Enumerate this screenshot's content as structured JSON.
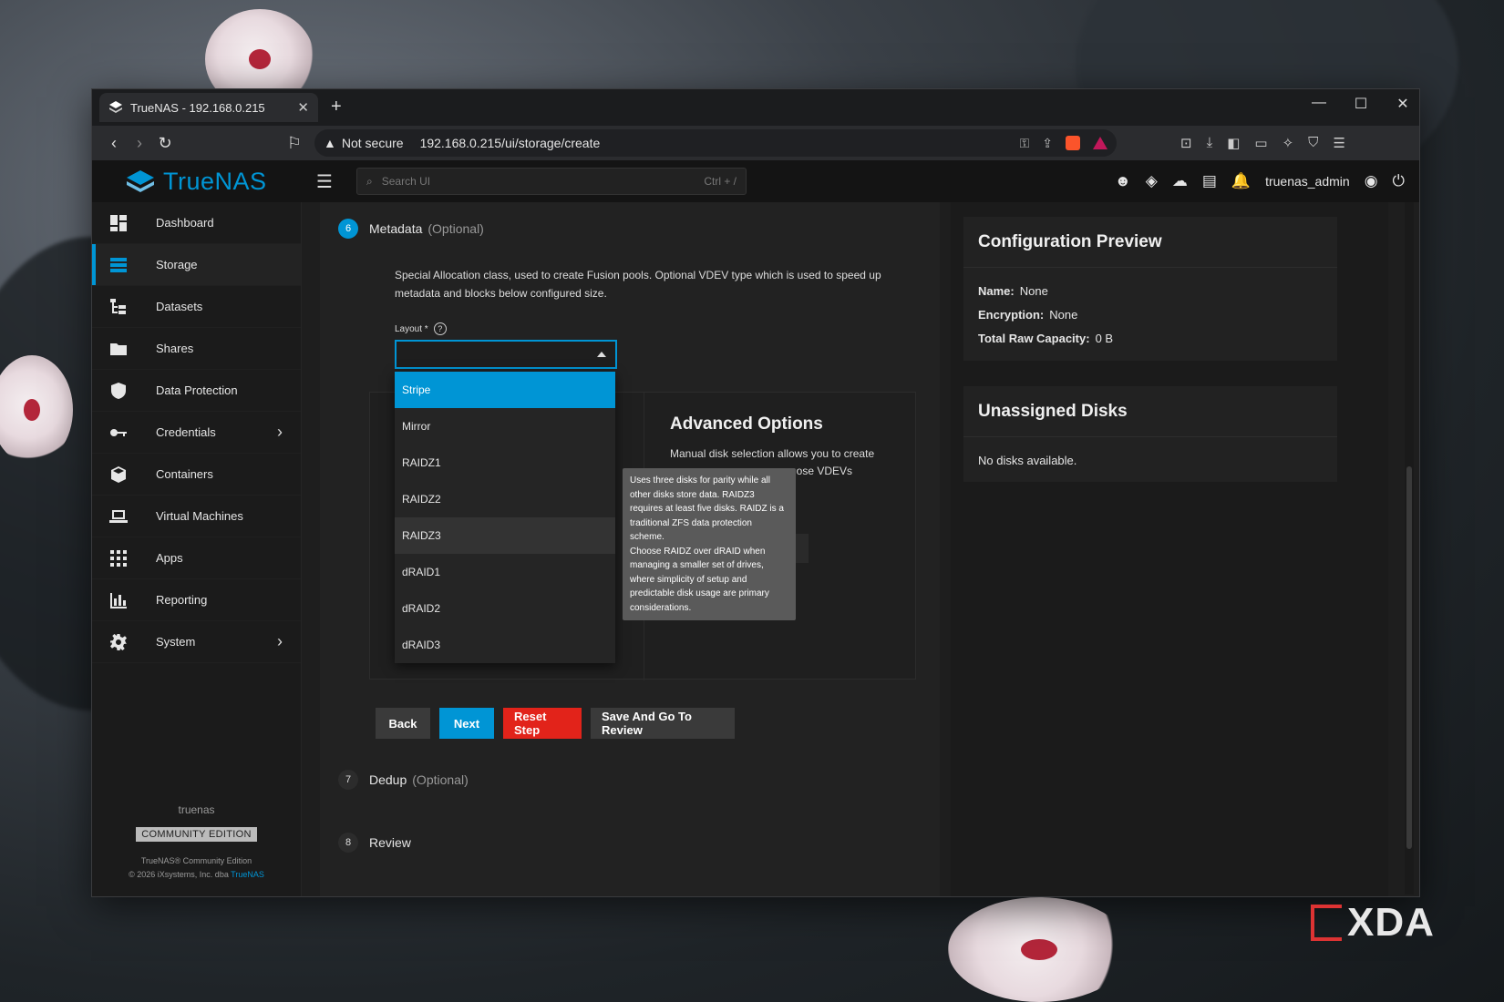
{
  "browser": {
    "tab_title": "TrueNAS - 192.168.0.215",
    "security": "Not secure",
    "url": "192.168.0.215/ui/storage/create"
  },
  "app": {
    "brand": "TrueNAS",
    "search_placeholder": "Search UI",
    "search_shortcut": "Ctrl + /",
    "username": "truenas_admin"
  },
  "sidebar": {
    "items": [
      {
        "label": "Dashboard",
        "icon": "dashboard-icon"
      },
      {
        "label": "Storage",
        "icon": "storage-icon"
      },
      {
        "label": "Datasets",
        "icon": "datasets-icon"
      },
      {
        "label": "Shares",
        "icon": "shares-icon"
      },
      {
        "label": "Data Protection",
        "icon": "shield-icon"
      },
      {
        "label": "Credentials",
        "icon": "key-icon"
      },
      {
        "label": "Containers",
        "icon": "cube-icon"
      },
      {
        "label": "Virtual Machines",
        "icon": "laptop-icon"
      },
      {
        "label": "Apps",
        "icon": "apps-grid-icon"
      },
      {
        "label": "Reporting",
        "icon": "bar-chart-icon"
      },
      {
        "label": "System",
        "icon": "gear-icon"
      }
    ],
    "hostname": "truenas",
    "edition": "COMMUNITY EDITION",
    "copyright_line1": "TrueNAS® Community Edition",
    "copyright_line2": "© 2026 iXsystems, Inc. dba",
    "copyright_link": "TrueNAS"
  },
  "wizard": {
    "step6": {
      "number": "6",
      "title": "Metadata",
      "optional": "(Optional)"
    },
    "description": "Special Allocation class, used to create Fusion pools. Optional VDEV type which is used to speed up metadata and blocks below configured size.",
    "layout_label": "Layout *",
    "layout_options": [
      "Stripe",
      "Mirror",
      "RAIDZ1",
      "RAIDZ2",
      "RAIDZ3",
      "dRAID1",
      "dRAID2",
      "dRAID3"
    ],
    "selected_option": "Stripe",
    "hovered_option": "RAIDZ3",
    "tooltip": "Uses three disks for parity while all other disks store data. RAIDZ3 requires at least five disks. RAIDZ is a traditional ZFS data protection scheme.\nChoose RAIDZ over dRAID when managing a smaller set of drives, where simplicity of setup and predictable disk usage are primary considerations.",
    "advanced_title": "Advanced Options",
    "advanced_text_visible": "Manual disk selection allows you to create",
    "advanced_text_partial": "ose VDEVs",
    "buttons": {
      "back": "Back",
      "next": "Next",
      "reset": "Reset Step",
      "save_review": "Save And Go To Review"
    },
    "step7": {
      "number": "7",
      "title": "Dedup",
      "optional": "(Optional)"
    },
    "step8": {
      "number": "8",
      "title": "Review"
    }
  },
  "config_preview": {
    "title": "Configuration Preview",
    "name_label": "Name:",
    "name_value": "None",
    "encryption_label": "Encryption:",
    "encryption_value": "None",
    "capacity_label": "Total Raw Capacity:",
    "capacity_value": "0 B"
  },
  "unassigned": {
    "title": "Unassigned Disks",
    "message": "No disks available."
  },
  "watermark": "XDA",
  "colors": {
    "accent": "#0095d5",
    "danger": "#e2231a"
  }
}
